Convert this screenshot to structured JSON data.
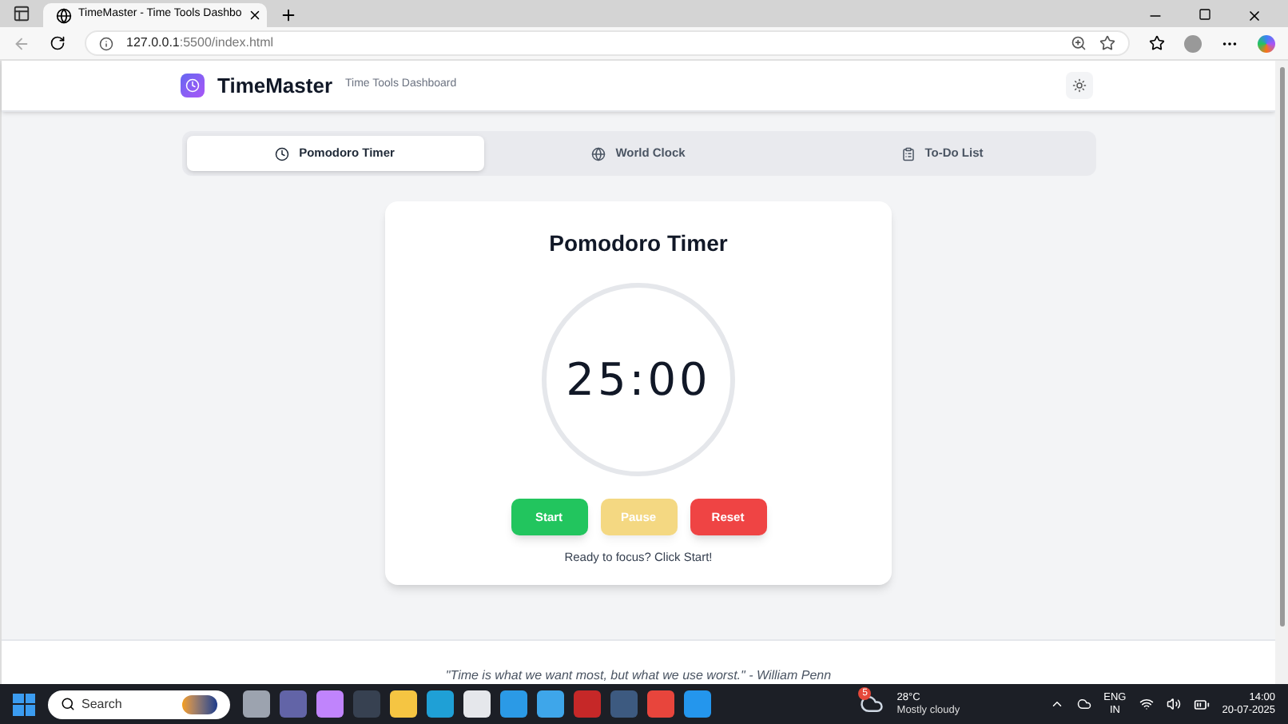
{
  "browser": {
    "tab_title": "TimeMaster - Time Tools Dashbo",
    "url_host": "127.0.0.1",
    "url_path": ":5500/index.html"
  },
  "header": {
    "brand": "TimeMaster",
    "subtitle": "Time Tools Dashboard"
  },
  "tabs": [
    {
      "label": "Pomodoro Timer",
      "kind": "clock",
      "selected": true
    },
    {
      "label": "World Clock",
      "kind": "globe",
      "selected": false
    },
    {
      "label": "To-Do List",
      "kind": "clipboard",
      "selected": false
    }
  ],
  "timer": {
    "title": "Pomodoro Timer",
    "time": "25:00",
    "status": "Ready to focus? Click Start!"
  },
  "buttons": [
    {
      "label": "Start",
      "kind": "start",
      "disabled": false
    },
    {
      "label": "Pause",
      "kind": "pause",
      "disabled": true
    },
    {
      "label": "Reset",
      "kind": "reset",
      "disabled": false
    }
  ],
  "footer": {
    "quote": "\"Time is what we want most, but what we use worst.\" - William Penn"
  },
  "taskbar": {
    "search": "Search",
    "weather_badge": "5",
    "temperature": "28°C",
    "weather": "Mostly cloudy",
    "language": "ENG",
    "region": "IN",
    "time": "14:00",
    "date": "20-07-2025"
  }
}
